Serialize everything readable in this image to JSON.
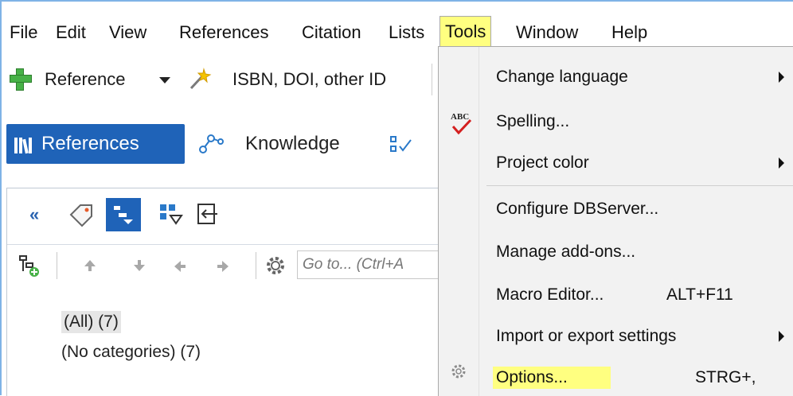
{
  "menubar": {
    "items": [
      "File",
      "Edit",
      "View",
      "References",
      "Citation",
      "Lists",
      "Tools",
      "Window",
      "Help"
    ]
  },
  "toolbar": {
    "reference_label": "Reference",
    "identifier_label": "ISBN, DOI, other ID"
  },
  "tabs": {
    "references": "References",
    "knowledge": "Knowledge"
  },
  "category_panel": {
    "goto_placeholder": "Go to... (Ctrl+A",
    "categories": [
      "(All) (7)",
      "(No categories) (7)"
    ]
  },
  "tools_menu": {
    "items": [
      {
        "label": "Change language",
        "submenu": true
      },
      {
        "label": "Spelling...",
        "submenu": false
      },
      {
        "label": "Project color",
        "submenu": true
      },
      {
        "label": "Configure DBServer...",
        "submenu": false
      },
      {
        "label": "Manage add-ons...",
        "submenu": false
      },
      {
        "label": "Macro Editor...",
        "shortcut": "ALT+F11",
        "submenu": false
      },
      {
        "label": "Import or export settings",
        "submenu": true
      },
      {
        "label": "Options...",
        "shortcut": "STRG+,",
        "submenu": false
      }
    ]
  },
  "colors": {
    "highlight": "#ffff80",
    "tab_active": "#1f63b8",
    "accent_blue": "#2a63b0"
  }
}
